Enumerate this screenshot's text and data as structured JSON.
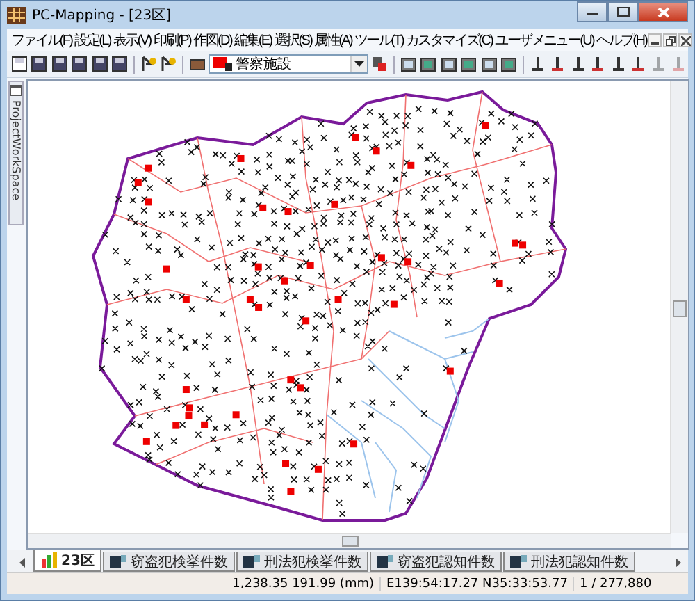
{
  "window": {
    "title": "PC-Mapping - [23区]"
  },
  "menu": [
    {
      "label": "ファイル(F)"
    },
    {
      "label": "設定(L)"
    },
    {
      "label": "表示(V)"
    },
    {
      "label": "印刷(P)"
    },
    {
      "label": "作図(D)"
    },
    {
      "label": "編集(E)"
    },
    {
      "label": "選択(S)"
    },
    {
      "label": "属性(A)"
    },
    {
      "label": "ツール(T)"
    },
    {
      "label": "カスタマイズ(C)"
    },
    {
      "label": "ユーザメニュー(U)"
    },
    {
      "label": "ヘルプ(H)"
    }
  ],
  "toolbar": {
    "layer_combo": {
      "value": "警察施設"
    }
  },
  "side_panel": {
    "label": "ProjectWorkSpace"
  },
  "tabs": [
    {
      "label": "23区",
      "kind": "map",
      "selected": true
    },
    {
      "label": "窃盗犯検挙件数",
      "kind": "layer",
      "selected": false
    },
    {
      "label": "刑法犯検挙件数",
      "kind": "layer",
      "selected": false
    },
    {
      "label": "窃盗犯認知件数",
      "kind": "layer",
      "selected": false
    },
    {
      "label": "刑法犯認知件数",
      "kind": "layer",
      "selected": false
    }
  ],
  "status_bar": {
    "paper_coords": "1,238.35 191.99 (mm)",
    "geo_coords": "E139:54:17.27 N35:33:53.77",
    "scale": "1 / 277,880"
  }
}
